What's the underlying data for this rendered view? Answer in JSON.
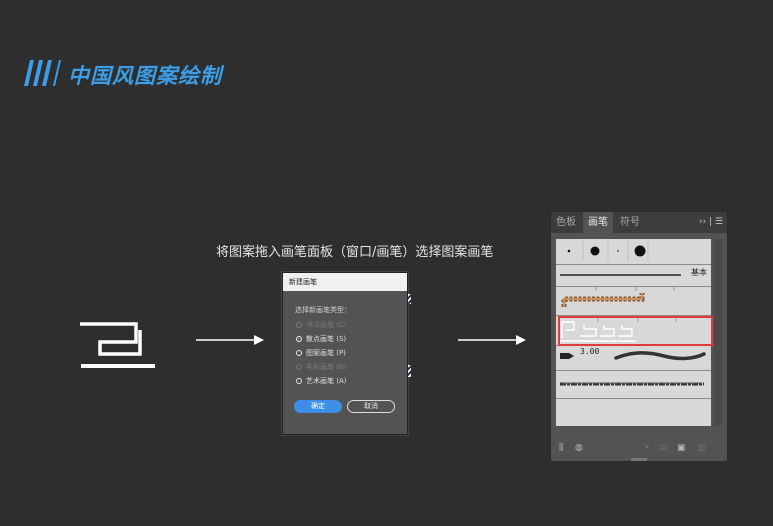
{
  "header": {
    "title": "中国风图案绘制",
    "accent": "#3d9ee8"
  },
  "caption": "将图案拖入画笔面板（窗口/画笔）选择图案画笔",
  "dialog": {
    "title": "新建画笔",
    "label": "选择新画笔类型：",
    "options": [
      {
        "label": "书法画笔 (C)",
        "state": "disabled"
      },
      {
        "label": "散点画笔 (S)",
        "state": "selected"
      },
      {
        "label": "图案画笔 (P)",
        "state": "normal"
      },
      {
        "label": "毛刷画笔 (B)",
        "state": "disabled"
      },
      {
        "label": "艺术画笔 (A)",
        "state": "normal"
      }
    ],
    "ok": "确定",
    "cancel": "取消"
  },
  "panel": {
    "tabs": [
      "色板",
      "画笔",
      "符号"
    ],
    "active_tab": "画笔",
    "menu": "›› | ☰",
    "basic_label": "基本",
    "stroke_size": "3.00",
    "highlight_color": "#e03a3a"
  }
}
